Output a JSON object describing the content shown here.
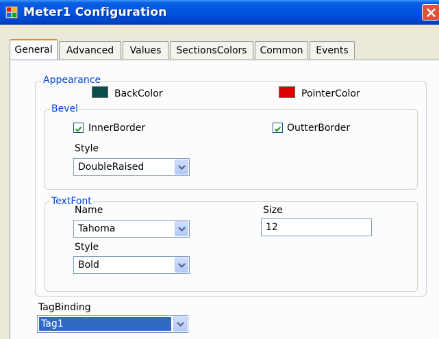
{
  "window": {
    "title": "Meter1 Configuration",
    "app_icon": "app-icon",
    "close_icon": "close-icon"
  },
  "tabs": [
    {
      "label": "General",
      "active": true
    },
    {
      "label": "Advanced",
      "active": false
    },
    {
      "label": "Values",
      "active": false
    },
    {
      "label": "SectionsColors",
      "active": false
    },
    {
      "label": "Common",
      "active": false
    },
    {
      "label": "Events",
      "active": false
    }
  ],
  "appearance": {
    "legend": "Appearance",
    "backcolor_label": "BackColor",
    "backcolor_value": "#0b4d4d",
    "pointercolor_label": "PointerColor",
    "pointercolor_value": "#dd0000"
  },
  "bevel": {
    "legend": "Bevel",
    "innerborder_label": "InnerBorder",
    "innerborder_checked": true,
    "outterborder_label": "OutterBorder",
    "outterborder_checked": true,
    "style_label": "Style",
    "style_value": "DoubleRaised"
  },
  "textfont": {
    "legend": "TextFont",
    "name_label": "Name",
    "name_value": "Tahoma",
    "size_label": "Size",
    "size_value": "12",
    "style_label": "Style",
    "style_value": "Bold"
  },
  "tagbinding": {
    "label": "TagBinding",
    "value": "Tag1"
  }
}
